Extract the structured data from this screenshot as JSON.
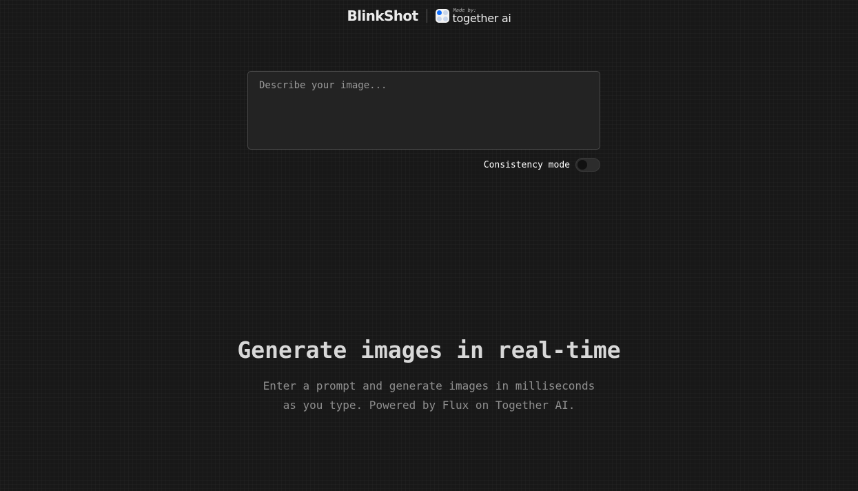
{
  "header": {
    "brand": "BlinkShot",
    "made_by_label": "Made by:",
    "maker_name": "together ai",
    "logo_icon": "together-ai-logo-icon"
  },
  "prompt": {
    "placeholder": "Describe your image...",
    "value": ""
  },
  "consistency": {
    "label": "Consistency mode",
    "enabled": false
  },
  "hero": {
    "title": "Generate images in real-time",
    "subtitle_line1": "Enter a prompt and generate images in milliseconds",
    "subtitle_line2": "as you type. Powered by Flux on Together AI."
  },
  "colors": {
    "background": "#181818",
    "input_background": "#232323",
    "accent_blue": "#0f6fff"
  }
}
